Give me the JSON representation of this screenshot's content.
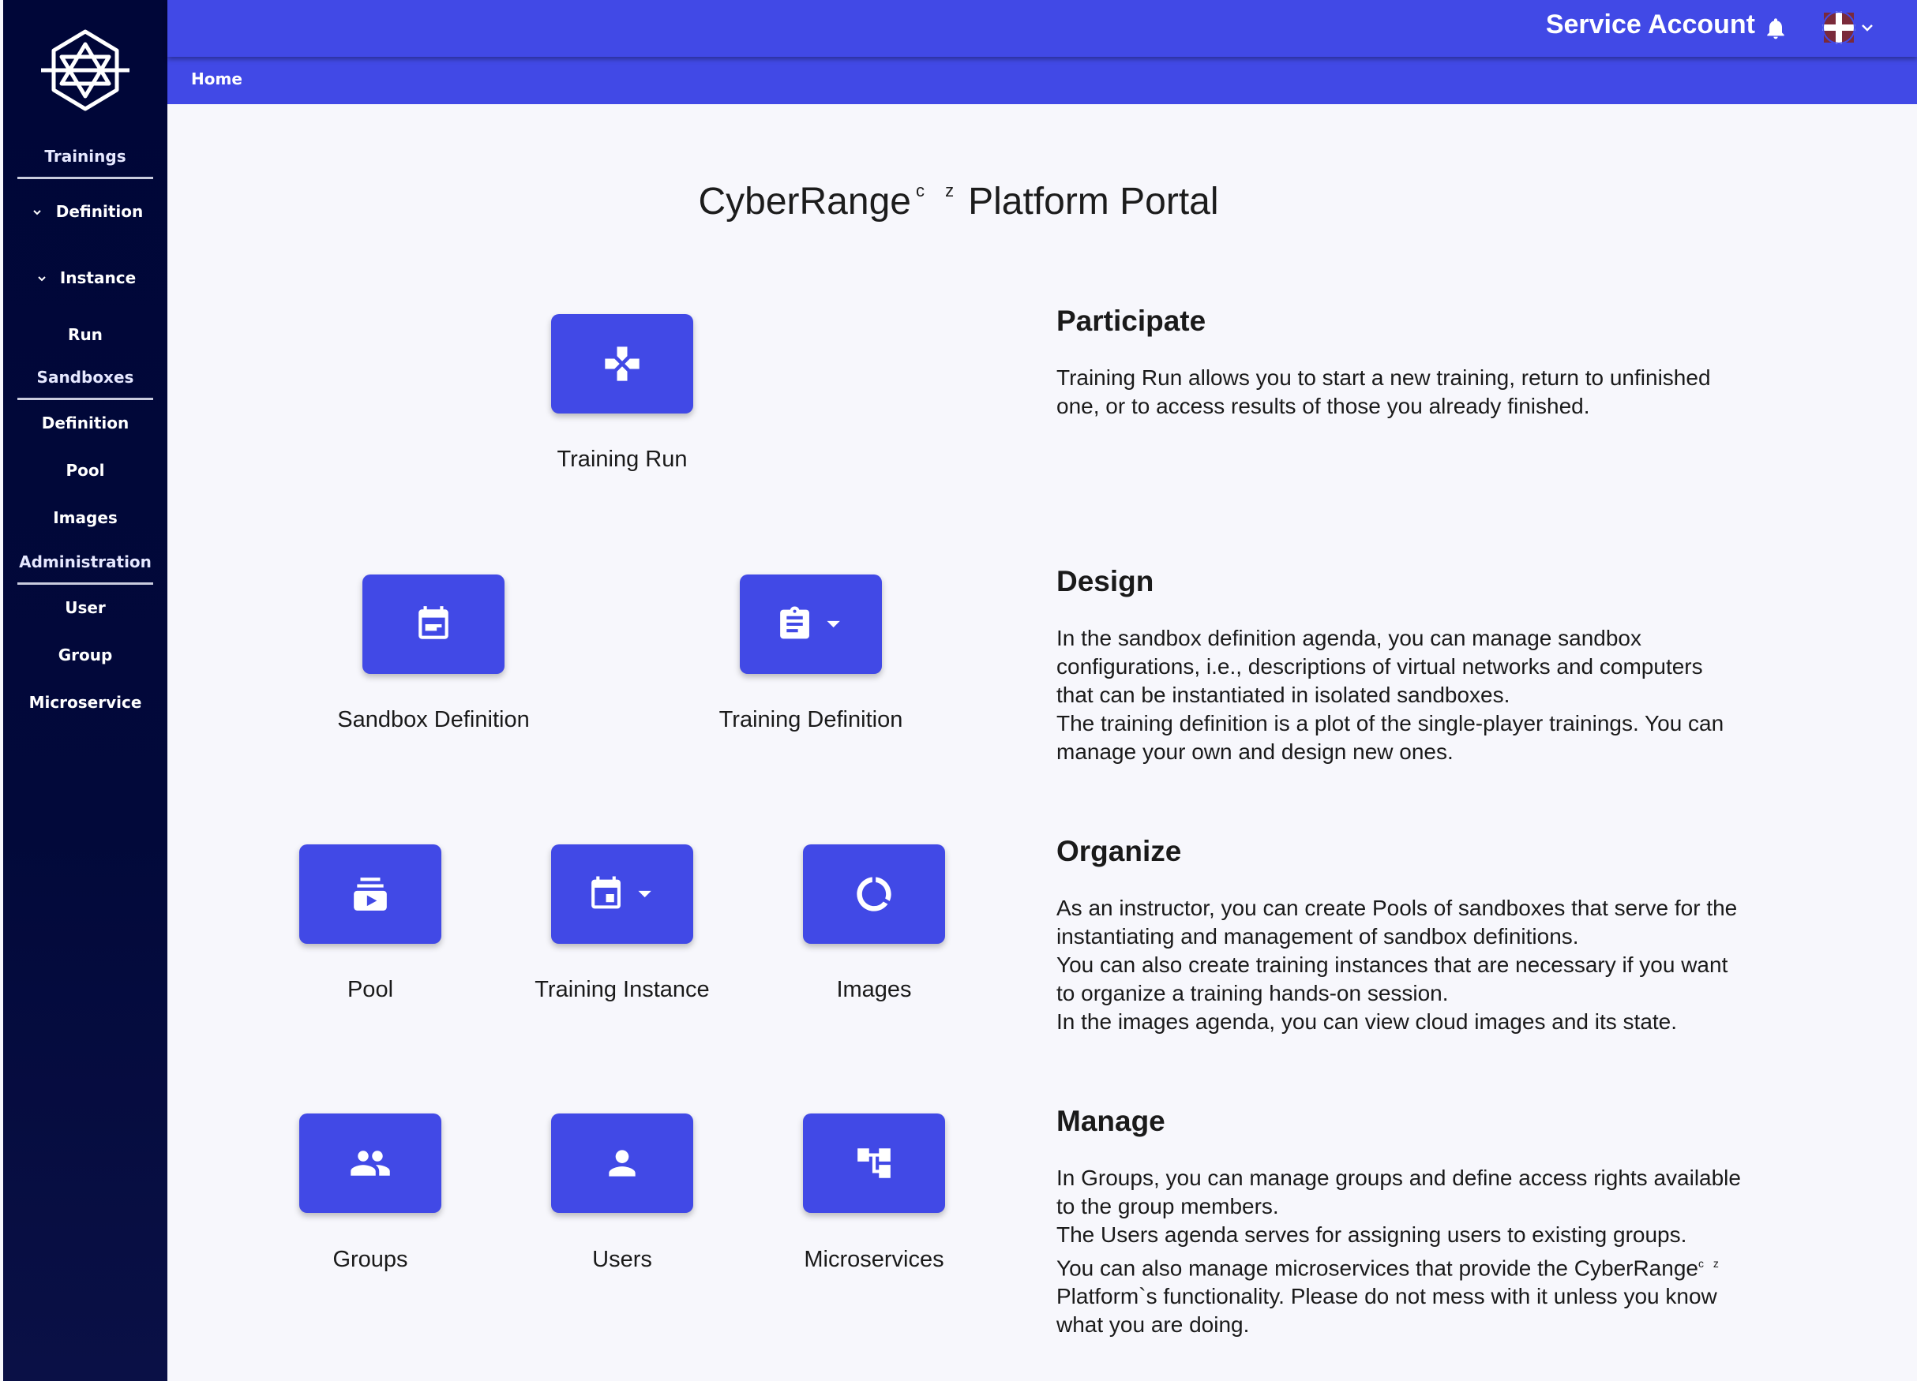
{
  "sidebar": {
    "items": [
      {
        "label": "Trainings",
        "kind": "section"
      },
      {
        "label": "Definition",
        "kind": "expandable"
      },
      {
        "label": "Instance",
        "kind": "expandable"
      },
      {
        "label": "Run",
        "kind": "item"
      },
      {
        "label": "Sandboxes",
        "kind": "section"
      },
      {
        "label": "Definition",
        "kind": "item"
      },
      {
        "label": "Pool",
        "kind": "item"
      },
      {
        "label": "Images",
        "kind": "item"
      },
      {
        "label": "Administration",
        "kind": "section"
      },
      {
        "label": "User",
        "kind": "item"
      },
      {
        "label": "Group",
        "kind": "item"
      },
      {
        "label": "Microservice",
        "kind": "item"
      }
    ]
  },
  "header": {
    "account_name": "Service Account",
    "breadcrumb": "Home",
    "icons": {
      "notifications": "bell-icon",
      "avatar": "user-avatar-icon",
      "menu": "chevron-down-icon"
    }
  },
  "main": {
    "title": "CyberRange",
    "title_sup": "c z",
    "title_suffix": "Platform Portal",
    "tiles": {
      "training_run": {
        "label": "Training Run",
        "icon": "gamepad-icon"
      },
      "sandbox_definition": {
        "label": "Sandbox Definition",
        "icon": "calendar-note-icon"
      },
      "training_definition": {
        "label": "Training Definition",
        "icon": "clipboard-icon"
      },
      "pool": {
        "label": "Pool",
        "icon": "subscriptions-icon"
      },
      "training_instance": {
        "label": "Training Instance",
        "icon": "calendar-event-icon"
      },
      "images": {
        "label": "Images",
        "icon": "donut-icon"
      },
      "groups": {
        "label": "Groups",
        "icon": "group-icon"
      },
      "users": {
        "label": "Users",
        "icon": "person-icon"
      },
      "microservices": {
        "label": "Microservices",
        "icon": "account-tree-icon"
      }
    },
    "sections": {
      "participate": {
        "title": "Participate",
        "lines": [
          "Training Run allows you to start a new training, return to unfinished",
          "one, or to access results of those you already finished."
        ]
      },
      "design": {
        "title": "Design",
        "lines": [
          "In the sandbox definition agenda, you can manage sandbox",
          "configurations, i.e., descriptions of virtual networks and computers",
          "that can be instantiated in isolated sandboxes.",
          "The training definition is a plot of the single-player trainings. You can",
          "manage your own and design new ones."
        ]
      },
      "organize": {
        "title": "Organize",
        "lines": [
          "As an instructor, you can create Pools of sandboxes that serve for the",
          "instantiating and management of sandbox definitions.",
          "You can also create training instances that are necessary if you want",
          "to organize a training hands-on session.",
          "In the images agenda, you can view cloud images and its state."
        ]
      },
      "manage": {
        "title": "Manage",
        "lines": [
          "In Groups, you can manage groups and define access rights available",
          "to the group members.",
          "The Users agenda serves for assigning users to existing groups.",
          "You can also manage microservices that provide the CyberRange",
          "Platform`s functionality. Please do not mess with it unless you know",
          "what you are doing."
        ],
        "line4_sup": "c z"
      }
    }
  },
  "colors": {
    "accent": "#4149e6",
    "sidebar": "#000638",
    "background": "#f7f7fc"
  }
}
